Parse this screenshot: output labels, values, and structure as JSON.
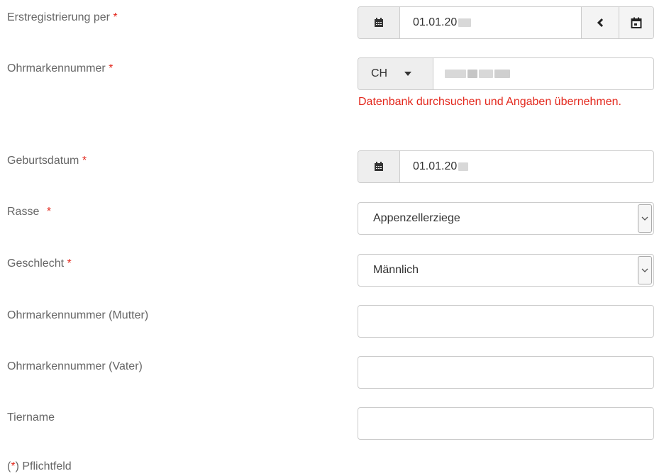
{
  "fields": {
    "registration": {
      "label": "Erstregistrierung per",
      "value": "01.01.20"
    },
    "ear_tag": {
      "label": "Ohrmarkennummer",
      "country": "CH",
      "error": "Datenbank durchsuchen und Angaben übernehmen."
    },
    "birth_date": {
      "label": "Geburtsdatum",
      "value": "01.01.20"
    },
    "breed": {
      "label": "Rasse",
      "value": "Appenzellerziege"
    },
    "sex": {
      "label": "Geschlecht",
      "value": "Männlich"
    },
    "mother_tag": {
      "label": "Ohrmarkennummer (Mutter)",
      "value": ""
    },
    "father_tag": {
      "label": "Ohrmarkennummer (Vater)",
      "value": ""
    },
    "animal_name": {
      "label": "Tiername",
      "value": ""
    }
  },
  "required_marker": "*",
  "footer": {
    "open": "(",
    "marker": "*",
    "close": ") Pflichtfeld"
  },
  "colors": {
    "required": "#e3281d",
    "label": "#666666",
    "border": "#cccccc",
    "addon_bg": "#eeeeee"
  },
  "icons": {
    "calendar": "calendar-icon",
    "prev": "chevron-left-icon",
    "calendar_today": "calendar-today-icon",
    "caret": "caret-down-icon",
    "select_arrow": "chevron-down-icon"
  }
}
